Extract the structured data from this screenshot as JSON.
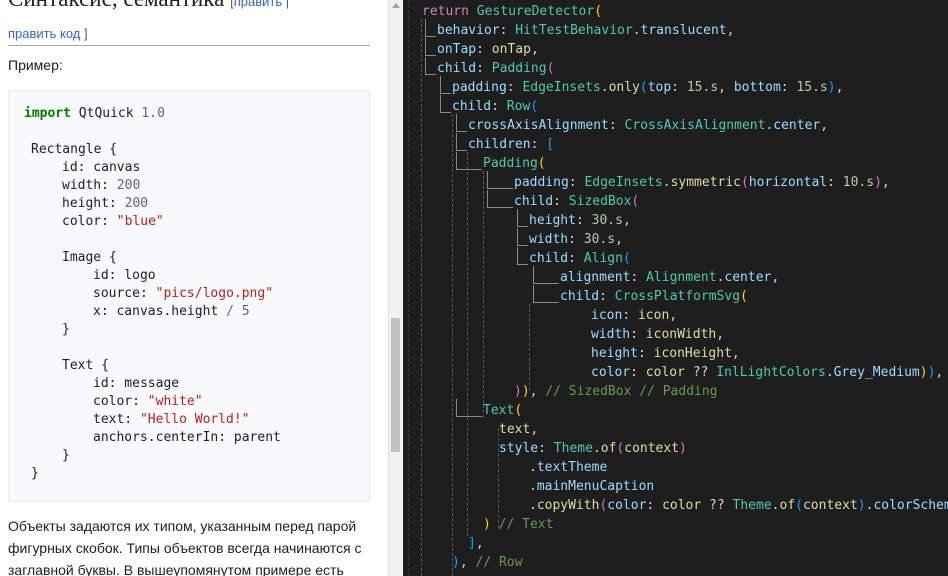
{
  "wiki": {
    "heading_fragment": "Синтаксис, семантика",
    "edit_link_open": " [",
    "edit_link": "править",
    "edit_link_close": " |",
    "edit_code_link": "править код",
    "edit_code_close": " ]",
    "example_label": "Пример:",
    "paragraph": "Объекты задаются их типом, указанным перед парой фигурных скобок. Типы объектов всегда начинаются с заглавной буквы. В вышеупомянутом примере есть"
  },
  "qml_code": {
    "l1_kw": "import",
    "l1_mod": " QtQuick ",
    "l1_ver": "1.0",
    "l2": "Rectangle {",
    "l3_key": "id:",
    "l3_val": " canvas",
    "l4_key": "width:",
    "l4_val": " 200",
    "l5_key": "height:",
    "l5_val": " 200",
    "l6_key": "color:",
    "l6_val": " \"blue\"",
    "l7": "Image {",
    "l8_key": "id:",
    "l8_val": " logo",
    "l9_key": "source:",
    "l9_val": " \"pics/logo.png\"",
    "l10_key": "x:",
    "l10_val": " canvas.height ",
    "l10_op": "/",
    "l10_num": " 5",
    "l11": "}",
    "l12": "Text {",
    "l13_key": "id:",
    "l13_val": " message",
    "l14_key": "color:",
    "l14_val": " \"white\"",
    "l15_key": "text:",
    "l15_val": " \"Hello World!\"",
    "l16_key": "anchors.centerIn:",
    "l16_val": " parent",
    "l17": "}",
    "l18": "}"
  },
  "editor": {
    "theme_bg": "#1e1e1e",
    "lines": [
      [
        [
          "return ",
          "kw"
        ],
        [
          "GestureDetector",
          "cls"
        ],
        [
          "(",
          "br1"
        ]
      ],
      [
        [
          "behavior",
          "prm"
        ],
        [
          ": ",
          "pun"
        ],
        [
          "HitTestBehavior",
          "cls"
        ],
        [
          ".",
          "pun"
        ],
        [
          "translucent",
          "prm"
        ],
        [
          ",",
          "pun"
        ]
      ],
      [
        [
          "onTap",
          "prm"
        ],
        [
          ": ",
          "pun"
        ],
        [
          "onTap",
          "id"
        ],
        [
          ",",
          "pun"
        ]
      ],
      [
        [
          "child",
          "prm"
        ],
        [
          ": ",
          "pun"
        ],
        [
          "Padding",
          "cls"
        ],
        [
          "(",
          "br2"
        ]
      ],
      [
        [
          "padding",
          "prm"
        ],
        [
          ": ",
          "pun"
        ],
        [
          "EdgeInsets",
          "cls"
        ],
        [
          ".",
          "pun"
        ],
        [
          "only",
          "fn"
        ],
        [
          "(",
          "br3"
        ],
        [
          "top",
          "prm"
        ],
        [
          ": ",
          "pun"
        ],
        [
          "15.s",
          "num"
        ],
        [
          ", ",
          "pun"
        ],
        [
          "bottom",
          "prm"
        ],
        [
          ": ",
          "pun"
        ],
        [
          "15.s",
          "num"
        ],
        [
          ")",
          "br3"
        ],
        [
          ",",
          "pun"
        ]
      ],
      [
        [
          "child",
          "prm"
        ],
        [
          ": ",
          "pun"
        ],
        [
          "Row",
          "cls"
        ],
        [
          "(",
          "br3"
        ]
      ],
      [
        [
          "crossAxisAlignment",
          "prm"
        ],
        [
          ": ",
          "pun"
        ],
        [
          "CrossAxisAlignment",
          "cls"
        ],
        [
          ".",
          "pun"
        ],
        [
          "center",
          "prm"
        ],
        [
          ",",
          "pun"
        ]
      ],
      [
        [
          "children",
          "prm"
        ],
        [
          ": ",
          "pun"
        ],
        [
          "[",
          "br3"
        ]
      ],
      [
        [
          "Padding",
          "cls"
        ],
        [
          "(",
          "br1"
        ]
      ],
      [
        [
          "padding",
          "prm"
        ],
        [
          ": ",
          "pun"
        ],
        [
          "EdgeInsets",
          "cls"
        ],
        [
          ".",
          "pun"
        ],
        [
          "symmetric",
          "fn"
        ],
        [
          "(",
          "br2"
        ],
        [
          "horizontal",
          "prm"
        ],
        [
          ": ",
          "pun"
        ],
        [
          "10.s",
          "num"
        ],
        [
          ")",
          "br2"
        ],
        [
          ",",
          "pun"
        ]
      ],
      [
        [
          "child",
          "prm"
        ],
        [
          ": ",
          "pun"
        ],
        [
          "SizedBox",
          "cls"
        ],
        [
          "(",
          "br2"
        ]
      ],
      [
        [
          "height",
          "prm"
        ],
        [
          ": ",
          "pun"
        ],
        [
          "30.s",
          "num"
        ],
        [
          ",",
          "pun"
        ]
      ],
      [
        [
          "width",
          "prm"
        ],
        [
          ": ",
          "pun"
        ],
        [
          "30.s",
          "num"
        ],
        [
          ",",
          "pun"
        ]
      ],
      [
        [
          "child",
          "prm"
        ],
        [
          ": ",
          "pun"
        ],
        [
          "Align",
          "cls"
        ],
        [
          "(",
          "br3"
        ]
      ],
      [
        [
          "alignment",
          "prm"
        ],
        [
          ": ",
          "pun"
        ],
        [
          "Alignment",
          "cls"
        ],
        [
          ".",
          "pun"
        ],
        [
          "center",
          "prm"
        ],
        [
          ",",
          "pun"
        ]
      ],
      [
        [
          "child",
          "prm"
        ],
        [
          ": ",
          "pun"
        ],
        [
          "CrossPlatformSvg",
          "cls"
        ],
        [
          "(",
          "br1"
        ]
      ],
      [
        [
          "icon",
          "prm"
        ],
        [
          ": ",
          "pun"
        ],
        [
          "icon",
          "id"
        ],
        [
          ",",
          "pun"
        ]
      ],
      [
        [
          "width",
          "prm"
        ],
        [
          ": ",
          "pun"
        ],
        [
          "iconWidth",
          "id"
        ],
        [
          ",",
          "pun"
        ]
      ],
      [
        [
          "height",
          "prm"
        ],
        [
          ": ",
          "pun"
        ],
        [
          "iconHeight",
          "id"
        ],
        [
          ",",
          "pun"
        ]
      ],
      [
        [
          "color",
          "prm"
        ],
        [
          ": ",
          "pun"
        ],
        [
          "color",
          "id"
        ],
        [
          " ?? ",
          "pun"
        ],
        [
          "InlLightColors",
          "cls"
        ],
        [
          ".",
          "pun"
        ],
        [
          "Grey_Medium",
          "prm"
        ],
        [
          ")",
          "br1"
        ],
        [
          ")",
          "br3"
        ],
        [
          ",",
          "pun"
        ]
      ],
      [
        [
          ")",
          "br2"
        ],
        [
          ")",
          "br1"
        ],
        [
          ", ",
          "pun"
        ],
        [
          "// SizedBox // Padding",
          "cm"
        ]
      ],
      [
        [
          "Text",
          "cls"
        ],
        [
          "(",
          "br1"
        ]
      ],
      [
        [
          "text",
          "id"
        ],
        [
          ",",
          "pun"
        ]
      ],
      [
        [
          "style",
          "prm"
        ],
        [
          ": ",
          "pun"
        ],
        [
          "Theme",
          "cls"
        ],
        [
          ".",
          "pun"
        ],
        [
          "of",
          "fn"
        ],
        [
          "(",
          "br2"
        ],
        [
          "context",
          "id"
        ],
        [
          ")",
          "br2"
        ]
      ],
      [
        [
          ".",
          "pun"
        ],
        [
          "textTheme",
          "prm"
        ]
      ],
      [
        [
          ".",
          "pun"
        ],
        [
          "mainMenuCaption",
          "prm"
        ]
      ],
      [
        [
          ".",
          "pun"
        ],
        [
          "copyWith",
          "fn"
        ],
        [
          "(",
          "br2"
        ],
        [
          "color",
          "prm"
        ],
        [
          ": ",
          "pun"
        ],
        [
          "color",
          "id"
        ],
        [
          " ?? ",
          "pun"
        ],
        [
          "Theme",
          "cls"
        ],
        [
          ".",
          "pun"
        ],
        [
          "of",
          "fn"
        ],
        [
          "(",
          "br3"
        ],
        [
          "context",
          "id"
        ],
        [
          ")",
          "br3"
        ],
        [
          ".",
          "pun"
        ],
        [
          "colorScheme",
          "prm"
        ]
      ],
      [
        [
          ")",
          "br1"
        ],
        [
          " ",
          "pun"
        ],
        [
          "// Text",
          "cm"
        ]
      ],
      [
        [
          "]",
          "br3"
        ],
        [
          ",",
          "pun"
        ]
      ],
      [
        [
          ")",
          "br3"
        ],
        [
          ", ",
          "pun"
        ],
        [
          "// Row",
          "cm"
        ]
      ]
    ]
  }
}
